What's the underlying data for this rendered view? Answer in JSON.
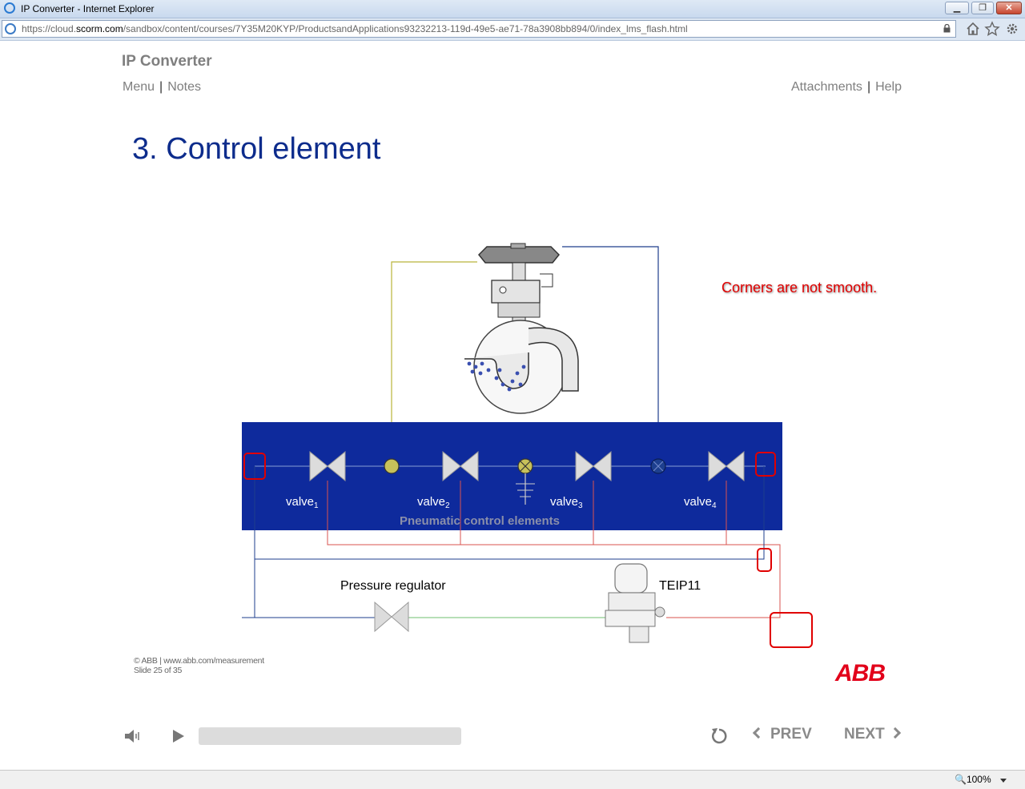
{
  "window": {
    "title": "IP Converter - Internet Explorer"
  },
  "address": {
    "url_prefix": "https://cloud.",
    "url_domain": "scorm.com",
    "url_rest": "/sandbox/content/courses/7Y35M20KYP/ProductsandApplications93232213-119d-49e5-ae71-78a3908bb894/0/index_lms_flash.html"
  },
  "course": {
    "title": "IP Converter",
    "nav_left": [
      "Menu",
      "Notes"
    ],
    "nav_right": [
      "Attachments",
      "Help"
    ]
  },
  "slide": {
    "title": "3. Control element",
    "annotation": "Corners are not smooth.",
    "valves": [
      "valve",
      "valve",
      "valve",
      "valve"
    ],
    "valve_subscripts": [
      "1",
      "2",
      "3",
      "4"
    ],
    "block_label": "Pneumatic control elements",
    "pressure_regulator": "Pressure regulator",
    "device": "TEIP11",
    "footer_line1": "© ABB | www.abb.com/measurement",
    "footer_line2": "Slide 25 of 35",
    "logo": "ABB"
  },
  "player": {
    "prev_label": "PREV",
    "next_label": "NEXT"
  },
  "status": {
    "zoom": "100%"
  },
  "colors": {
    "slide_title": "#0d2c8c",
    "block_bg": "#0e2a9c",
    "annotation": "#e00000",
    "logo": "#e2001a"
  },
  "icons": [
    "ie-icon",
    "lock-icon",
    "home-icon",
    "star-icon",
    "gear-icon",
    "speaker-icon",
    "play-icon",
    "replay-icon",
    "zoom-icon"
  ]
}
